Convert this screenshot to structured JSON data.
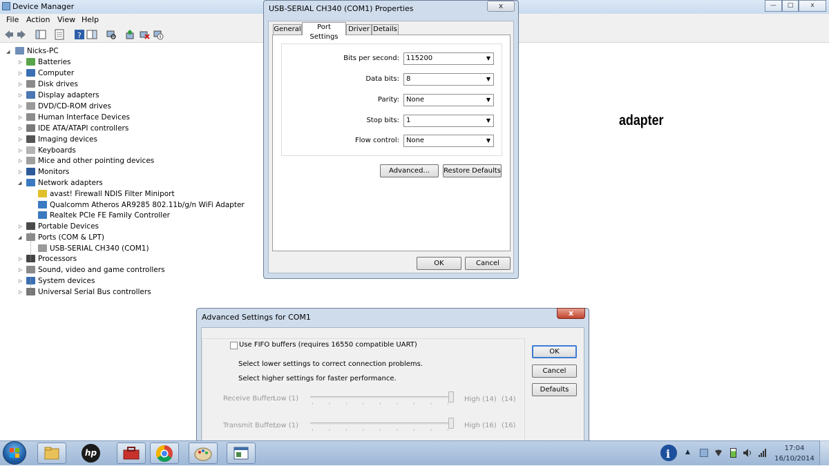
{
  "device_manager": {
    "title": "Device Manager",
    "menu": [
      "File",
      "Action",
      "View",
      "Help"
    ],
    "caption_buttons": {
      "minimize": "—",
      "maximize": "□",
      "close": "x"
    },
    "tree": {
      "root": "Nicks-PC",
      "items": [
        "Batteries",
        "Computer",
        "Disk drives",
        "Display adapters",
        "DVD/CD-ROM drives",
        "Human Interface Devices",
        "IDE ATA/ATAPI controllers",
        "Imaging devices",
        "Keyboards",
        "Mice and other pointing devices",
        "Monitors",
        "Network adapters",
        "avast! Firewall NDIS Filter Miniport",
        "Qualcomm Atheros AR9285 802.11b/g/n WiFi Adapter",
        "Realtek PCIe FE Family Controller",
        "Portable Devices",
        "Ports (COM & LPT)",
        "USB-SERIAL CH340 (COM1)",
        "Processors",
        "Sound, video and game controllers",
        "System devices",
        "Universal Serial Bus controllers"
      ]
    }
  },
  "overlay_text": "adapter",
  "properties_dialog": {
    "title": "USB-SERIAL CH340 (COM1) Properties",
    "close_glyph": "x",
    "tabs": [
      "General",
      "Port Settings",
      "Driver",
      "Details"
    ],
    "fields": {
      "bits_per_second": {
        "label": "Bits per second:",
        "value": "115200"
      },
      "data_bits": {
        "label": "Data bits:",
        "value": "8"
      },
      "parity": {
        "label": "Parity:",
        "value": "None"
      },
      "stop_bits": {
        "label": "Stop bits:",
        "value": "1"
      },
      "flow_control": {
        "label": "Flow control:",
        "value": "None"
      }
    },
    "advanced_label": "Advanced...",
    "restore_label": "Restore Defaults",
    "ok_label": "OK",
    "cancel_label": "Cancel"
  },
  "advanced_dialog": {
    "title": "Advanced Settings for COM1",
    "close_glyph": "x",
    "fifo_label": "Use FIFO buffers (requires 16550 compatible UART)",
    "fifo_checked": false,
    "hint_lower": "Select lower settings to correct connection problems.",
    "hint_higher": "Select higher settings for faster performance.",
    "receive": {
      "label": "Receive Buffer:",
      "low": "Low (1)",
      "high": "High (14)",
      "value": "(14)"
    },
    "transmit": {
      "label": "Transmit Buffer:",
      "low": "Low (1)",
      "high": "High (16)",
      "value": "(16)"
    },
    "ok_label": "OK",
    "cancel_label": "Cancel",
    "defaults_label": "Defaults"
  },
  "taskbar": {
    "time": "17:04",
    "date": "16/10/2014",
    "hp_label": "hp",
    "tray_chevron": "▲"
  },
  "colors": {
    "accent": "#3875d7",
    "selected_tab": "#ffffff",
    "close_red": "#c0442d"
  }
}
